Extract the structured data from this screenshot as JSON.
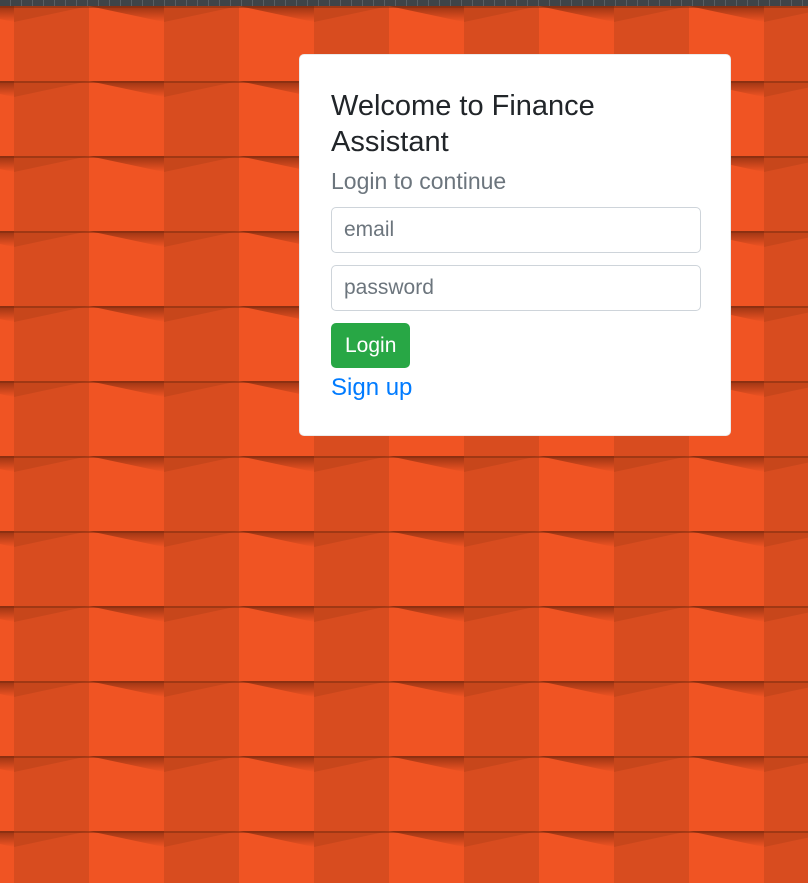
{
  "background": {
    "pattern": "orange-beveled-tile-wall",
    "colors": {
      "base": "#f05423",
      "dark": "#d84c1f",
      "shadow": "#9a3212"
    }
  },
  "login_card": {
    "title": "Welcome to Finance Assistant",
    "subtitle": "Login to continue",
    "email_placeholder": "email",
    "password_placeholder": "password",
    "login_label": "Login",
    "signup_label": "Sign up",
    "colors": {
      "login_button": "#28a745",
      "link": "#007bff"
    }
  }
}
